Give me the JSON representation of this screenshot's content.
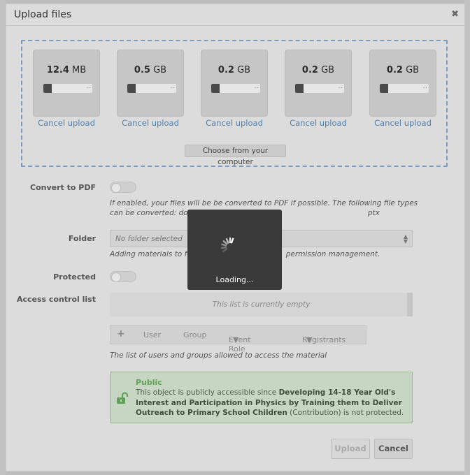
{
  "dialog": {
    "title": "Upload files",
    "close_icon": "close-icon"
  },
  "files": [
    {
      "size_value": "12.4",
      "size_unit": "MB",
      "cancel_label": "Cancel upload"
    },
    {
      "size_value": "0.5",
      "size_unit": "GB",
      "cancel_label": "Cancel upload"
    },
    {
      "size_value": "0.2",
      "size_unit": "GB",
      "cancel_label": "Cancel upload"
    },
    {
      "size_value": "0.2",
      "size_unit": "GB",
      "cancel_label": "Cancel upload"
    },
    {
      "size_value": "0.2",
      "size_unit": "GB",
      "cancel_label": "Cancel upload"
    }
  ],
  "choose_button": "Choose from your computer",
  "convert_pdf": {
    "label": "Convert to PDF",
    "help_line1": "If enabled, your files will be be converted to PDF if possible. The following file types",
    "help_line2_start": "can be converted: doc, d",
    "help_line2_end": "ptx"
  },
  "folder": {
    "label": "Folder",
    "placeholder": "No folder selected",
    "help_start": "Adding materials to folde",
    "help_end": "permission management."
  },
  "protected": {
    "label": "Protected"
  },
  "acl": {
    "label": "Access control list",
    "empty_text": "This list is currently empty",
    "toolbar": {
      "add_icon": "plus-icon",
      "user": "User",
      "group": "Group",
      "event_role": "Event Role",
      "registrants": "Registrants"
    },
    "help": "The list of users and groups allowed to access the material"
  },
  "notice": {
    "title": "Public",
    "body_prefix": "This object is publicly accessible since ",
    "body_link": "Developing 14-18 Year Old's Interest and Participation in Physics by Training them to Deliver Outreach to Primary School Children",
    "body_suffix": " (Contribution) is not protected.",
    "icon": "unlock-icon"
  },
  "buttons": {
    "upload": "Upload",
    "cancel": "Cancel"
  },
  "loading": {
    "text": "Loading...",
    "icon": "spinner-icon"
  },
  "colors": {
    "link": "#4f7fae",
    "notice_title": "#5fa257",
    "overlay": "#3a3a3a"
  }
}
